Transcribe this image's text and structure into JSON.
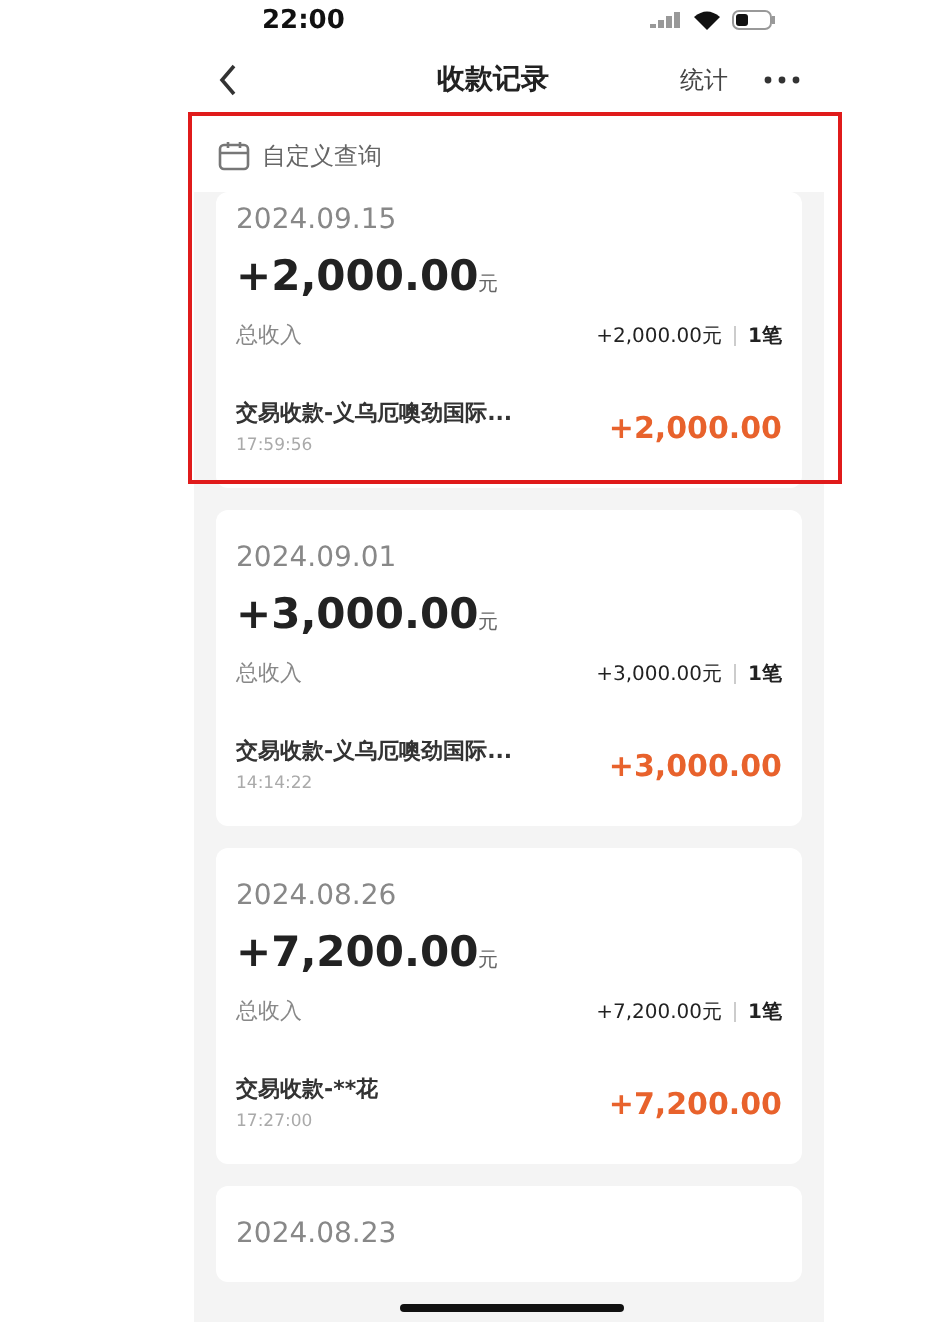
{
  "status_bar": {
    "time": "22:00"
  },
  "nav": {
    "title": "收款记录",
    "action": "统计"
  },
  "filter": {
    "label": "自定义查询"
  },
  "records": [
    {
      "date": "2024.09.15",
      "total": "+2,000.00",
      "unit": "元",
      "summary_label": "总收入",
      "summary_amount": "+2,000.00元",
      "count": "1笔",
      "highlighted": true,
      "items": [
        {
          "title": "交易收款-义乌厄噢劲国际...",
          "time": "17:59:56",
          "amount": "+2,000.00"
        }
      ]
    },
    {
      "date": "2024.09.01",
      "total": "+3,000.00",
      "unit": "元",
      "summary_label": "总收入",
      "summary_amount": "+3,000.00元",
      "count": "1笔",
      "highlighted": false,
      "items": [
        {
          "title": "交易收款-义乌厄噢劲国际...",
          "time": "14:14:22",
          "amount": "+3,000.00"
        }
      ]
    },
    {
      "date": "2024.08.26",
      "total": "+7,200.00",
      "unit": "元",
      "summary_label": "总收入",
      "summary_amount": "+7,200.00元",
      "count": "1笔",
      "highlighted": false,
      "items": [
        {
          "title": "交易收款-**花",
          "time": "17:27:00",
          "amount": "+7,200.00"
        }
      ]
    },
    {
      "date": "2024.08.23",
      "highlighted": false
    }
  ]
}
